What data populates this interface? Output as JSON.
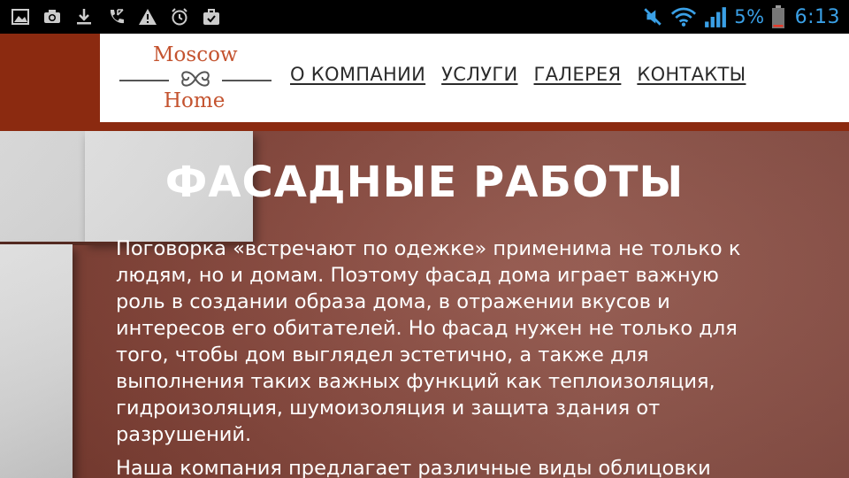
{
  "status_bar": {
    "left_icons": [
      "gallery-icon",
      "camera-icon",
      "download-icon",
      "call-icon",
      "warning-icon",
      "alarm-icon",
      "briefcase-icon"
    ],
    "right_icons": [
      "mute-icon",
      "wifi-icon",
      "signal-icon",
      "battery-icon"
    ],
    "battery": "5%",
    "time": "6:13",
    "accent_color": "#3aa0e6"
  },
  "logo": {
    "line1": "Moscow",
    "line2": "Home",
    "color": "#c4532f"
  },
  "nav": {
    "items": [
      {
        "label": "О КОМПАНИИ"
      },
      {
        "label": "УСЛУГИ"
      },
      {
        "label": "ГАЛЕРЕЯ"
      },
      {
        "label": "КОНТАКТЫ"
      }
    ]
  },
  "hero": {
    "title": "ФАСАДНЫЕ РАБОТЫ",
    "paragraph1": "Поговорка «встречают по одежке» применима не только к людям, но и домам. Поэтому фасад дома играет важную роль в создании образа дома, в отражении вкусов и интересов его обитателей. Но фасад нужен не только для того, чтобы дом выглядел эстетично, а также для выполнения таких важных функций как теплоизоляция, гидроизоляция, шумоизоляция и защита здания от разрушений.",
    "paragraph2": "Наша компания предлагает различные виды облицовки"
  },
  "colors": {
    "header_band": "#8b2a10",
    "hero_bg": "#8a4a3f"
  }
}
